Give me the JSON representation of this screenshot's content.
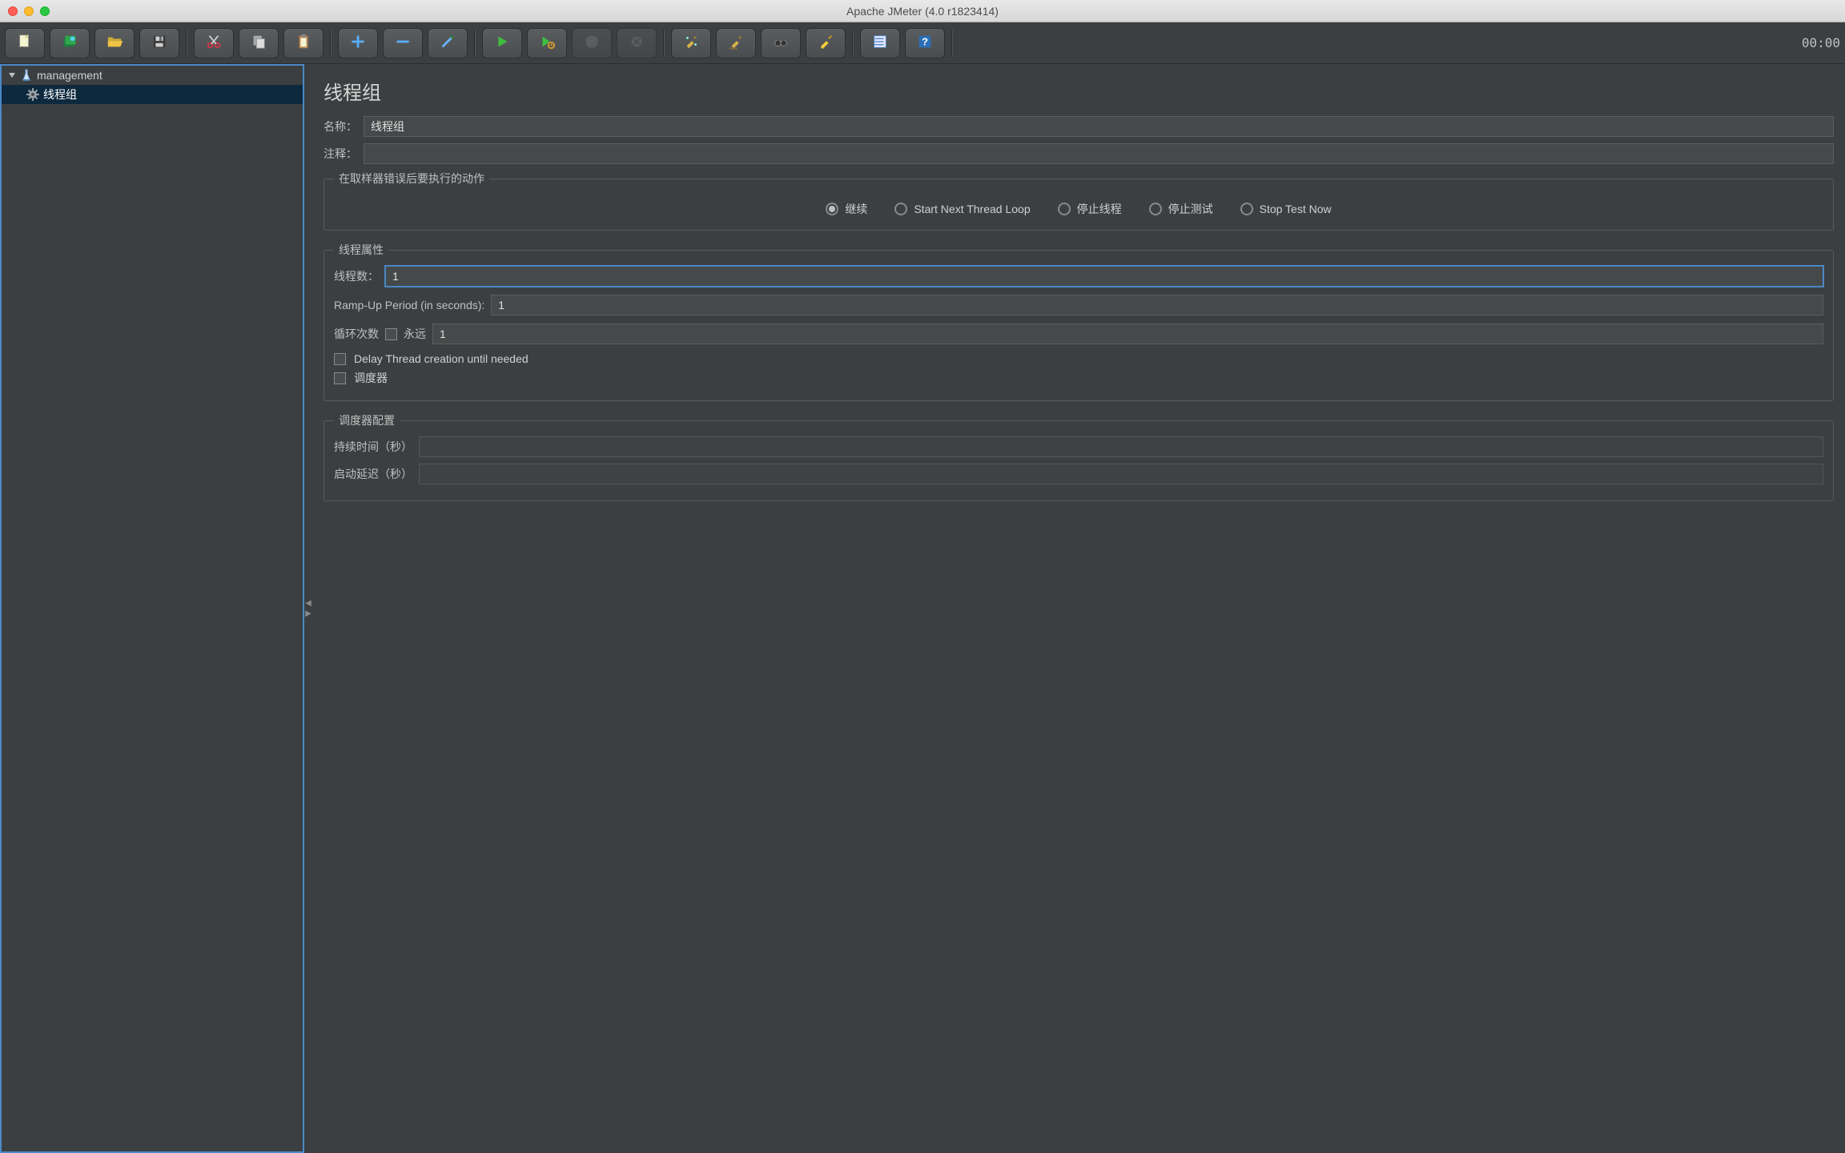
{
  "titlebar": {
    "title": "Apache JMeter (4.0 r1823414)"
  },
  "toolbar": {
    "timer": "00:00"
  },
  "tree": {
    "root": {
      "label": "management"
    },
    "child": {
      "label": "线程组"
    }
  },
  "panel": {
    "title": "线程组",
    "name_label": "名称：",
    "name_value": "线程组",
    "comment_label": "注释：",
    "comment_value": "",
    "error_action": {
      "legend": "在取样器错误后要执行的动作",
      "options": {
        "continue": "继续",
        "start_next": "Start Next Thread Loop",
        "stop_thread": "停止线程",
        "stop_test": "停止测试",
        "stop_test_now": "Stop Test Now"
      }
    },
    "thread_props": {
      "legend": "线程属性",
      "threads_label": "线程数：",
      "threads_value": "1",
      "ramp_label": "Ramp-Up Period (in seconds):",
      "ramp_value": "1",
      "loop_label": "循环次数",
      "forever_label": "永远",
      "loop_value": "1",
      "delay_label": "Delay Thread creation until needed",
      "scheduler_label": "调度器"
    },
    "scheduler": {
      "legend": "调度器配置",
      "duration_label": "持续时间（秒）",
      "delay_label": "启动延迟（秒）",
      "duration_value": "",
      "delay_value": ""
    }
  }
}
